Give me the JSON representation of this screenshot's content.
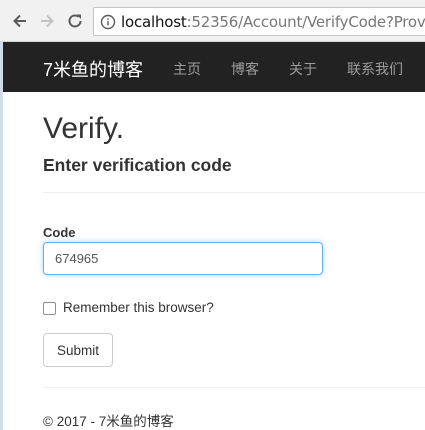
{
  "browser": {
    "url_host": "localhost",
    "url_rest": ":52356/Account/VerifyCode?Provide"
  },
  "navbar": {
    "brand": "7米鱼的博客",
    "links": [
      "主页",
      "博客",
      "关于",
      "联系我们"
    ]
  },
  "page": {
    "title": "Verify.",
    "subtitle": "Enter verification code"
  },
  "form": {
    "code_label": "Code",
    "code_value": "674965",
    "remember_label": "Remember this browser?",
    "remember_checked": false,
    "submit_label": "Submit"
  },
  "footer": {
    "text": "© 2017 - 7米鱼的博客"
  },
  "colors": {
    "navbar_bg": "#222222",
    "nav_link": "#9d9d9d",
    "input_focus": "#66afe9"
  }
}
